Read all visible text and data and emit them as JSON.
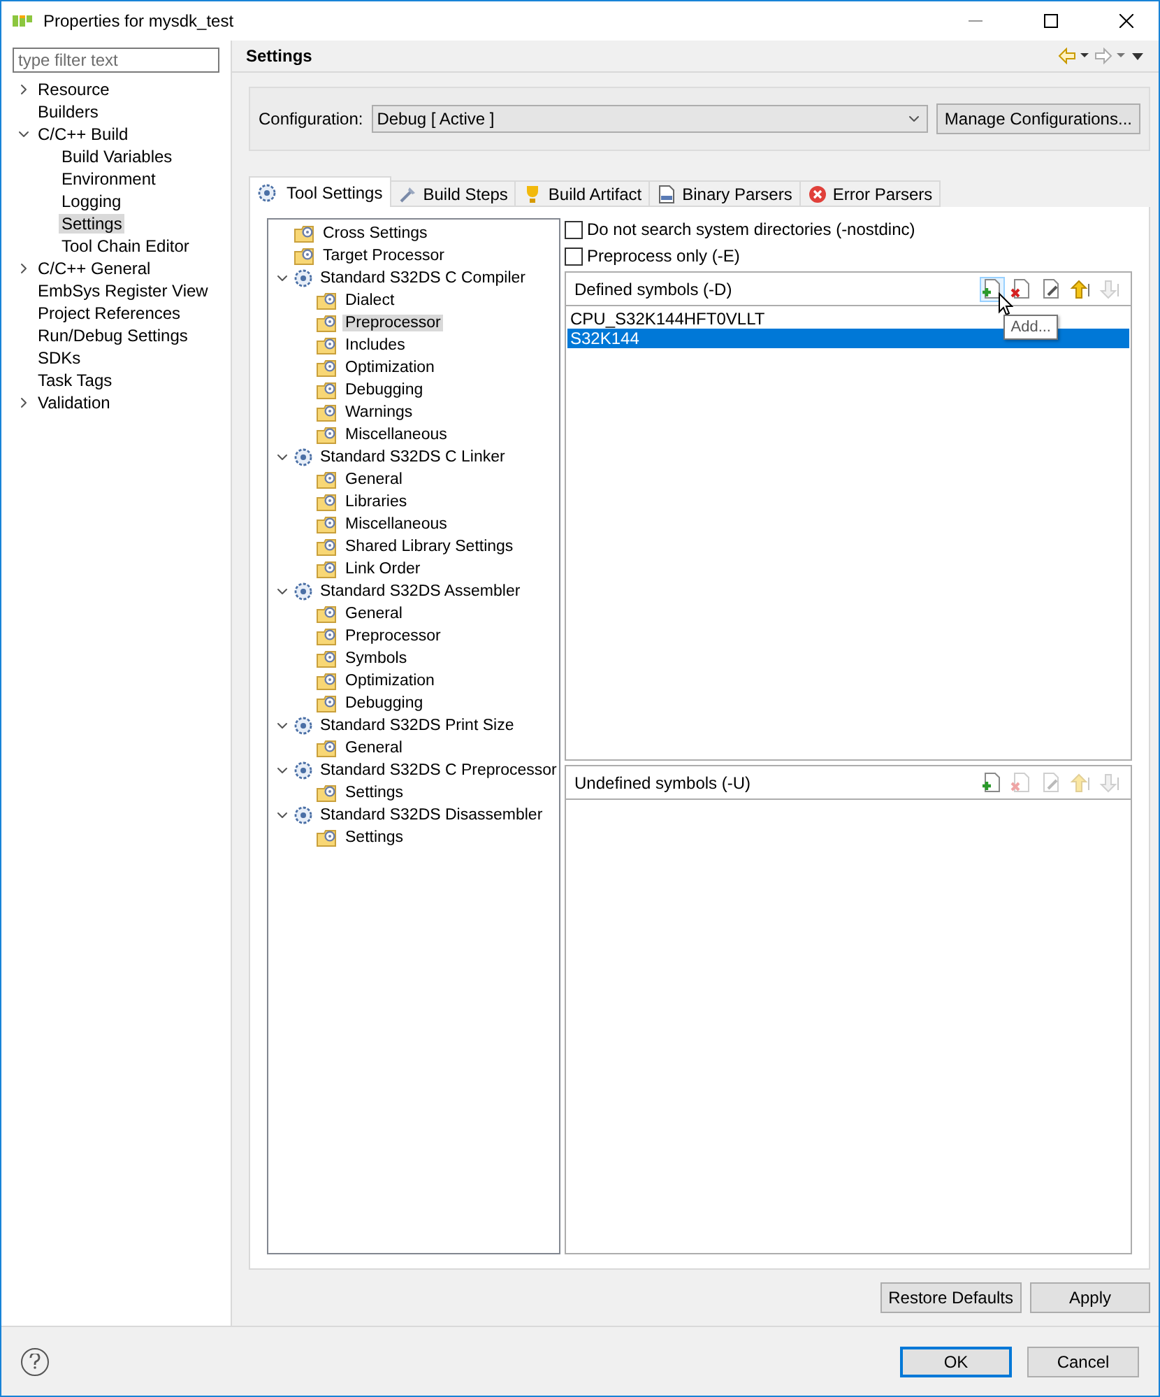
{
  "window": {
    "title": "Properties for mysdk_test"
  },
  "sidebar": {
    "filter": {
      "placeholder": "type filter text"
    },
    "items": [
      {
        "label": "Resource",
        "expanded": false,
        "selected": false
      },
      {
        "label": "Builders",
        "selected": false
      },
      {
        "label": "C/C++ Build",
        "expanded": true,
        "selected": false,
        "children": [
          {
            "label": "Build Variables",
            "selected": false
          },
          {
            "label": "Environment",
            "selected": false
          },
          {
            "label": "Logging",
            "selected": false
          },
          {
            "label": "Settings",
            "selected": true
          },
          {
            "label": "Tool Chain Editor",
            "selected": false
          }
        ]
      },
      {
        "label": "C/C++ General",
        "expanded": false,
        "selected": false
      },
      {
        "label": "EmbSys Register View",
        "selected": false
      },
      {
        "label": "Project References",
        "selected": false
      },
      {
        "label": "Run/Debug Settings",
        "selected": false
      },
      {
        "label": "SDKs",
        "selected": false
      },
      {
        "label": "Task Tags",
        "selected": false
      },
      {
        "label": "Validation",
        "expanded": false,
        "selected": false
      }
    ]
  },
  "header": {
    "title": "Settings"
  },
  "configuration": {
    "label": "Configuration:",
    "value": "Debug  [ Active ]",
    "button": "Manage Configurations..."
  },
  "tabs": [
    {
      "label": "Tool Settings",
      "kind": "gear",
      "selected": true
    },
    {
      "label": "Build Steps",
      "kind": "steps",
      "selected": false
    },
    {
      "label": "Build Artifact",
      "kind": "trophy",
      "selected": false
    },
    {
      "label": "Binary Parsers",
      "kind": "binary",
      "selected": false
    },
    {
      "label": "Error Parsers",
      "kind": "error",
      "selected": false
    }
  ],
  "tool_tree": [
    {
      "label": "Cross Settings",
      "kind": "category",
      "selected": false
    },
    {
      "label": "Target Processor",
      "kind": "category",
      "selected": false
    },
    {
      "label": "Standard S32DS C Compiler",
      "kind": "tool",
      "expanded": true,
      "selected": false,
      "children": [
        {
          "label": "Dialect",
          "kind": "category",
          "selected": false
        },
        {
          "label": "Preprocessor",
          "kind": "category",
          "selected": true
        },
        {
          "label": "Includes",
          "kind": "category",
          "selected": false
        },
        {
          "label": "Optimization",
          "kind": "category",
          "selected": false
        },
        {
          "label": "Debugging",
          "kind": "category",
          "selected": false
        },
        {
          "label": "Warnings",
          "kind": "category",
          "selected": false
        },
        {
          "label": "Miscellaneous",
          "kind": "category",
          "selected": false
        }
      ]
    },
    {
      "label": "Standard S32DS C Linker",
      "kind": "tool",
      "expanded": true,
      "selected": false,
      "children": [
        {
          "label": "General",
          "kind": "category",
          "selected": false
        },
        {
          "label": "Libraries",
          "kind": "category",
          "selected": false
        },
        {
          "label": "Miscellaneous",
          "kind": "category",
          "selected": false
        },
        {
          "label": "Shared Library Settings",
          "kind": "category",
          "selected": false
        },
        {
          "label": "Link Order",
          "kind": "category",
          "selected": false
        }
      ]
    },
    {
      "label": "Standard S32DS Assembler",
      "kind": "tool",
      "expanded": true,
      "selected": false,
      "children": [
        {
          "label": "General",
          "kind": "category",
          "selected": false
        },
        {
          "label": "Preprocessor",
          "kind": "category",
          "selected": false
        },
        {
          "label": "Symbols",
          "kind": "category",
          "selected": false
        },
        {
          "label": "Optimization",
          "kind": "category",
          "selected": false
        },
        {
          "label": "Debugging",
          "kind": "category",
          "selected": false
        }
      ]
    },
    {
      "label": "Standard S32DS Print Size",
      "kind": "tool",
      "expanded": true,
      "selected": false,
      "children": [
        {
          "label": "General",
          "kind": "category",
          "selected": false
        }
      ]
    },
    {
      "label": "Standard S32DS C Preprocessor",
      "kind": "tool",
      "expanded": true,
      "selected": false,
      "children": [
        {
          "label": "Settings",
          "kind": "category",
          "selected": false
        }
      ]
    },
    {
      "label": "Standard S32DS Disassembler",
      "kind": "tool",
      "expanded": true,
      "selected": false,
      "children": [
        {
          "label": "Settings",
          "kind": "category",
          "selected": false
        }
      ]
    }
  ],
  "options": [
    {
      "label": "Do not search system directories (-nostdinc)",
      "checked": false
    },
    {
      "label": "Preprocess only (-E)",
      "checked": false
    }
  ],
  "lists": [
    {
      "title": "Defined symbols (-D)",
      "tooltip": "Add...",
      "tools": [
        {
          "kind": "add",
          "disabled": false,
          "hovered": true
        },
        {
          "kind": "delete",
          "disabled": false,
          "hovered": false
        },
        {
          "kind": "edit",
          "disabled": false,
          "hovered": false
        },
        {
          "kind": "up",
          "disabled": false,
          "hovered": false
        },
        {
          "kind": "down",
          "disabled": true,
          "hovered": false
        }
      ],
      "items": [
        {
          "text": "CPU_S32K144HFT0VLLT",
          "selected": false
        },
        {
          "text": "S32K144",
          "selected": true
        }
      ]
    },
    {
      "title": "Undefined symbols (-U)",
      "tools": [
        {
          "kind": "add",
          "disabled": false,
          "hovered": false
        },
        {
          "kind": "delete",
          "disabled": true,
          "hovered": false
        },
        {
          "kind": "edit",
          "disabled": true,
          "hovered": false
        },
        {
          "kind": "up",
          "disabled": true,
          "hovered": false
        },
        {
          "kind": "down",
          "disabled": true,
          "hovered": false
        }
      ]
    }
  ],
  "page_buttons": [
    "Restore Defaults",
    "Apply"
  ],
  "dialog_buttons": [
    {
      "label": "OK",
      "default": true
    },
    {
      "label": "Cancel",
      "default": false
    }
  ]
}
